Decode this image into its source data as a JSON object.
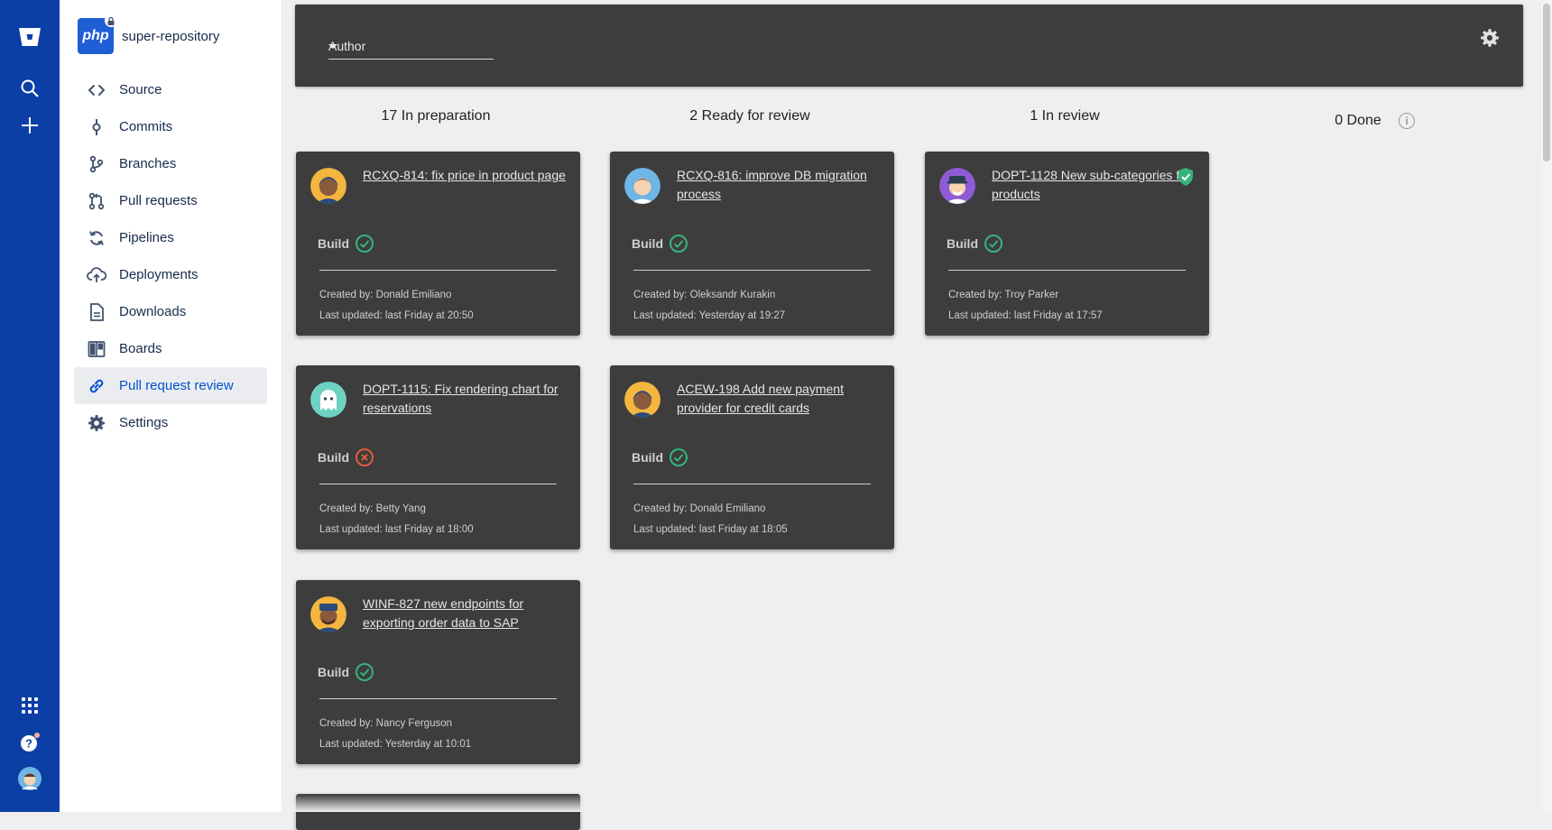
{
  "repo": {
    "logo_text": "php",
    "name": "super-repository"
  },
  "sidebar": {
    "items": [
      {
        "label": "Source",
        "icon": "code-icon"
      },
      {
        "label": "Commits",
        "icon": "commit-icon"
      },
      {
        "label": "Branches",
        "icon": "branch-icon"
      },
      {
        "label": "Pull requests",
        "icon": "pull-request-icon"
      },
      {
        "label": "Pipelines",
        "icon": "pipelines-icon"
      },
      {
        "label": "Deployments",
        "icon": "cloud-upload-icon"
      },
      {
        "label": "Downloads",
        "icon": "document-icon"
      },
      {
        "label": "Boards",
        "icon": "board-icon"
      },
      {
        "label": "Pull request review",
        "icon": "link-icon",
        "active": true
      },
      {
        "label": "Settings",
        "icon": "gear-icon"
      }
    ]
  },
  "filter": {
    "author_label": "Author"
  },
  "columns": [
    {
      "label": "17 In preparation"
    },
    {
      "label": "2 Ready for review"
    },
    {
      "label": "1 In review"
    },
    {
      "label": "0 Done"
    }
  ],
  "cards": [
    {
      "title": "RCXQ-814: fix price in product page",
      "build_label": "Build",
      "build_status": "success",
      "created": "Created by: Donald Emiliano",
      "updated": "Last updated: last Friday at 20:50",
      "avatar_color": "#f4b63f"
    },
    {
      "title": "DOPT-1115: Fix rendering chart for reservations",
      "build_label": "Build",
      "build_status": "failed",
      "created": "Created by: Betty Yang",
      "updated": "Last updated: last Friday at 18:00",
      "avatar_color": "#6fd1c4"
    },
    {
      "title": "WINF-827 new endpoints for exporting order data to SAP",
      "build_label": "Build",
      "build_status": "success",
      "created": "Created by: Nancy Ferguson",
      "updated": "Last updated: Yesterday at 10:01",
      "avatar_color": "#f4b63f"
    },
    {
      "title": "RCXQ-816: improve DB migration process",
      "build_label": "Build",
      "build_status": "success",
      "created": "Created by: Oleksandr Kurakin",
      "updated": "Last updated: Yesterday at 19:27",
      "avatar_color": "#6fb5e6"
    },
    {
      "title": "ACEW-198 Add new payment provider for credit cards",
      "build_label": "Build",
      "build_status": "success",
      "created": "Created by: Donald Emiliano",
      "updated": "Last updated: last Friday at 18:05",
      "avatar_color": "#f4b63f"
    },
    {
      "title": "DOPT-1128 New sub-categories for products",
      "build_label": "Build",
      "build_status": "success",
      "created": "Created by: Troy Parker",
      "updated": "Last updated: last Friday at 17:57",
      "avatar_color": "#8e5bd6",
      "verified": true
    }
  ],
  "colors": {
    "rail": "#0b3fa6",
    "card": "#3d3d3d",
    "success": "#36b37e",
    "failed": "#e2583e",
    "active_link": "#0052cc"
  }
}
